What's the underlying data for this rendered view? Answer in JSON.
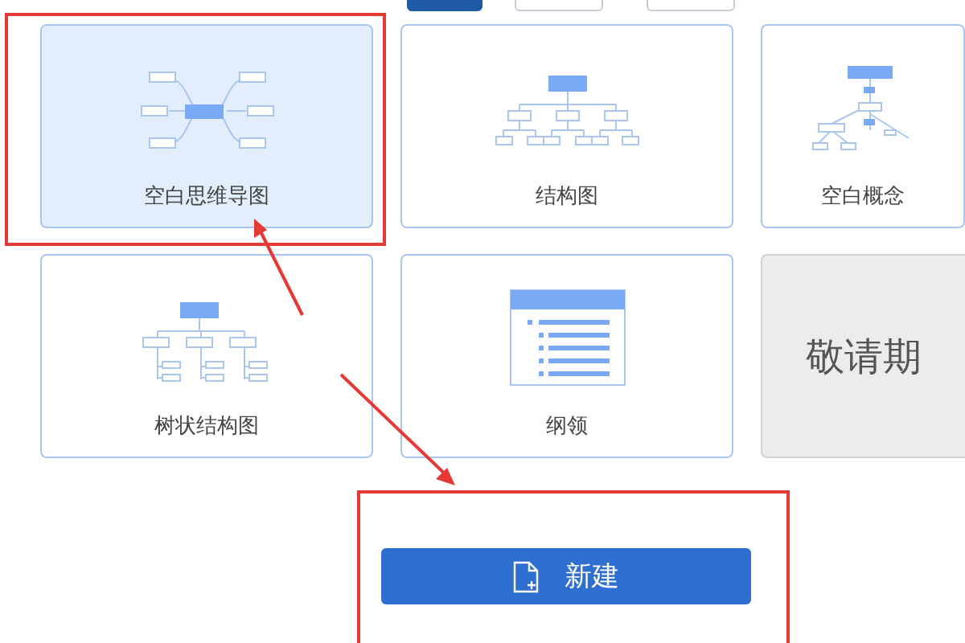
{
  "top_tabs": [
    {
      "selected": true
    },
    {
      "selected": false
    },
    {
      "selected": false
    }
  ],
  "templates": [
    {
      "kind": "mindmap",
      "label": "空白思维导图",
      "selected": true
    },
    {
      "kind": "org",
      "label": "结构图",
      "selected": false
    },
    {
      "kind": "concept",
      "label": "空白概念",
      "selected": false
    },
    {
      "kind": "tree",
      "label": "树状结构图",
      "selected": false
    },
    {
      "kind": "outline",
      "label": "纲领",
      "selected": false
    },
    {
      "kind": "coming_soon",
      "label": "敬请期",
      "selected": false
    }
  ],
  "new_button": {
    "label": "新建"
  }
}
